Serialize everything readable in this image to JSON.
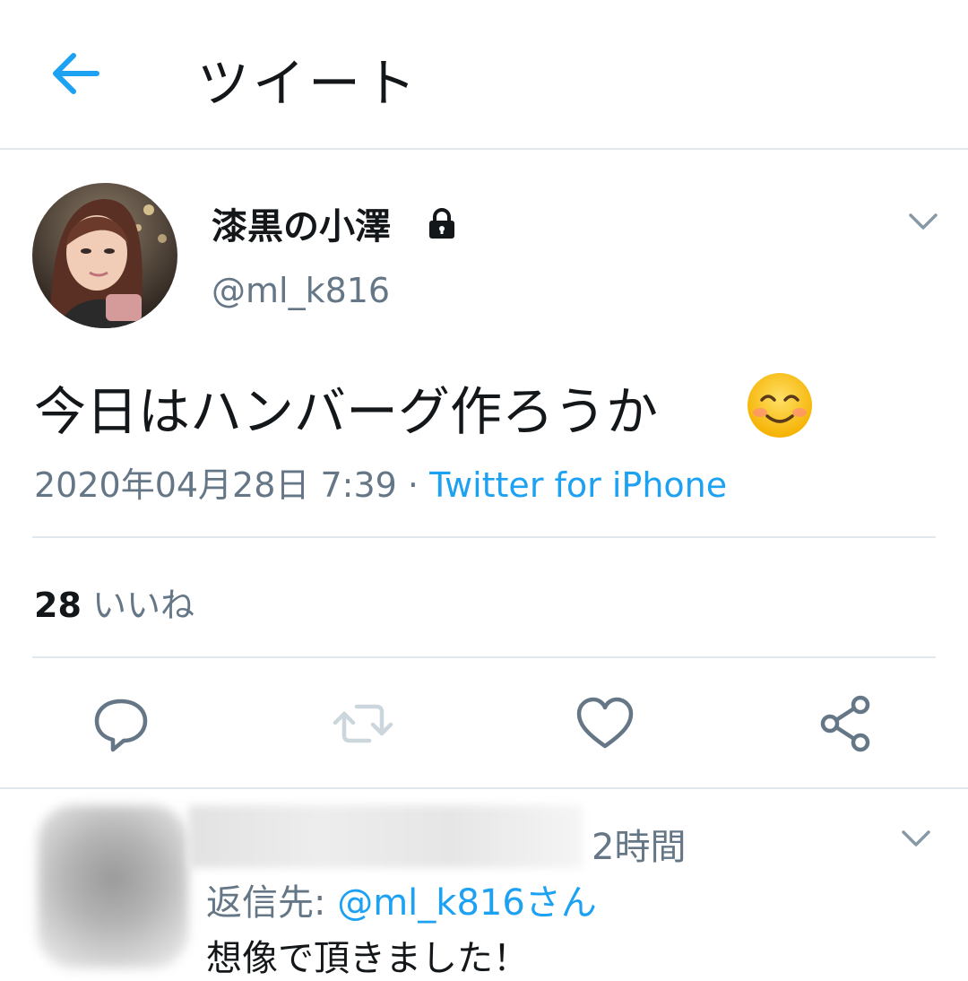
{
  "header": {
    "title": "ツイート",
    "back_icon": "arrow-left-icon"
  },
  "tweet": {
    "display_name": "漆黒の小澤",
    "handle": "@ml_k816",
    "protected_icon": "lock-icon",
    "text": "今日はハンバーグ作ろうか",
    "emoji_icon": "smiling-face-icon",
    "timestamp": "2020年04月28日 7:39",
    "separator": " · ",
    "source": "Twitter for iPhone",
    "like_count": "28",
    "like_label": "いいね"
  },
  "actions": [
    {
      "name": "reply-icon"
    },
    {
      "name": "retweet-icon"
    },
    {
      "name": "like-icon"
    },
    {
      "name": "share-icon"
    }
  ],
  "reply": {
    "time": "2時間",
    "reply_to_label": "返信先: ",
    "reply_to_handle": "@ml_k816さん",
    "text": "想像で頂きました！"
  },
  "colors": {
    "accent": "#1da1f2",
    "secondary_text": "#657786",
    "divider": "#e1e8ed"
  }
}
